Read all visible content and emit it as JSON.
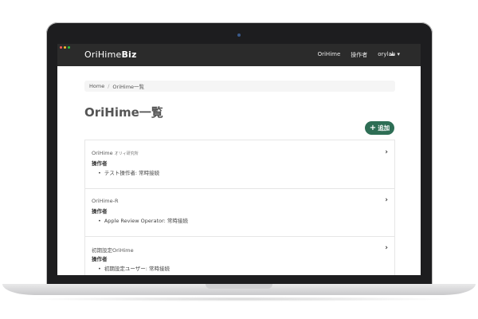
{
  "app": {
    "brand_light": "OriHime",
    "brand_bold": "Biz",
    "nav": [
      "OriHime",
      "操作者",
      "orylab ▾"
    ],
    "nav_icon": "cloud-icon"
  },
  "breadcrumb": {
    "home": "Home",
    "sep": "/",
    "current": "OriHime一覧"
  },
  "page_title": "OriHime一覧",
  "add_button": {
    "icon": "+",
    "label": "追加"
  },
  "items": [
    {
      "name": "OriHime",
      "suffix": "オリィ研究所",
      "label": "操作者",
      "operator": "テスト操作者: 常時接続"
    },
    {
      "name": "OriHime-R",
      "suffix": "",
      "label": "操作者",
      "operator": "Apple Review Operator: 常時接続"
    },
    {
      "name": "初期設定OriHime",
      "suffix": "",
      "label": "操作者",
      "operator": "初期設定ユーザー: 常時接続"
    }
  ],
  "colors": {
    "navbar": "#2b2b2b",
    "accent": "#2e6e55"
  }
}
